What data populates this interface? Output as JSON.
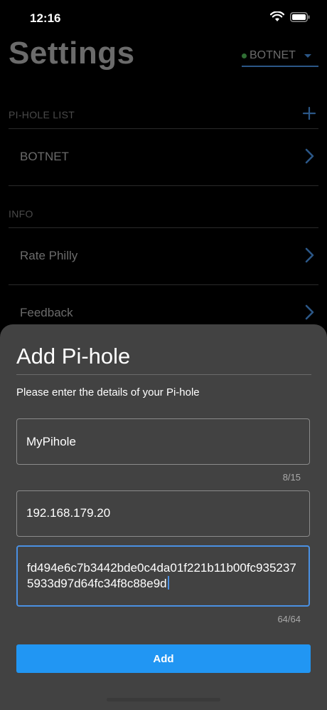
{
  "status_bar": {
    "time": "12:16"
  },
  "settings": {
    "title": "Settings",
    "server_selector": {
      "label": "BOTNET",
      "status_color": "#2f6e33"
    },
    "pihole_list": {
      "header": "PI-HOLE LIST",
      "items": [
        {
          "label": "BOTNET"
        }
      ]
    },
    "info": {
      "header": "INFO",
      "items": [
        {
          "label": "Rate Philly"
        },
        {
          "label": "Feedback"
        }
      ]
    }
  },
  "add_sheet": {
    "title": "Add Pi-hole",
    "subtitle": "Please enter the details of your Pi-hole",
    "name_field": {
      "value": "MyPihole",
      "counter": "8/15"
    },
    "address_field": {
      "value": "192.168.179.20"
    },
    "token_field": {
      "value": "fd494e6c7b3442bde0c4da01f221b11b00fc9352375933d97d64fc34f8c88e9d",
      "counter": "64/64"
    },
    "add_button_label": "Add"
  },
  "colors": {
    "accent": "#2196f3",
    "sheet_background": "#424242",
    "focus_border": "#4a90e2"
  },
  "icons": [
    "wifi-icon",
    "battery-icon",
    "add-icon",
    "chevron-right-icon",
    "dropdown-caret-icon"
  ]
}
